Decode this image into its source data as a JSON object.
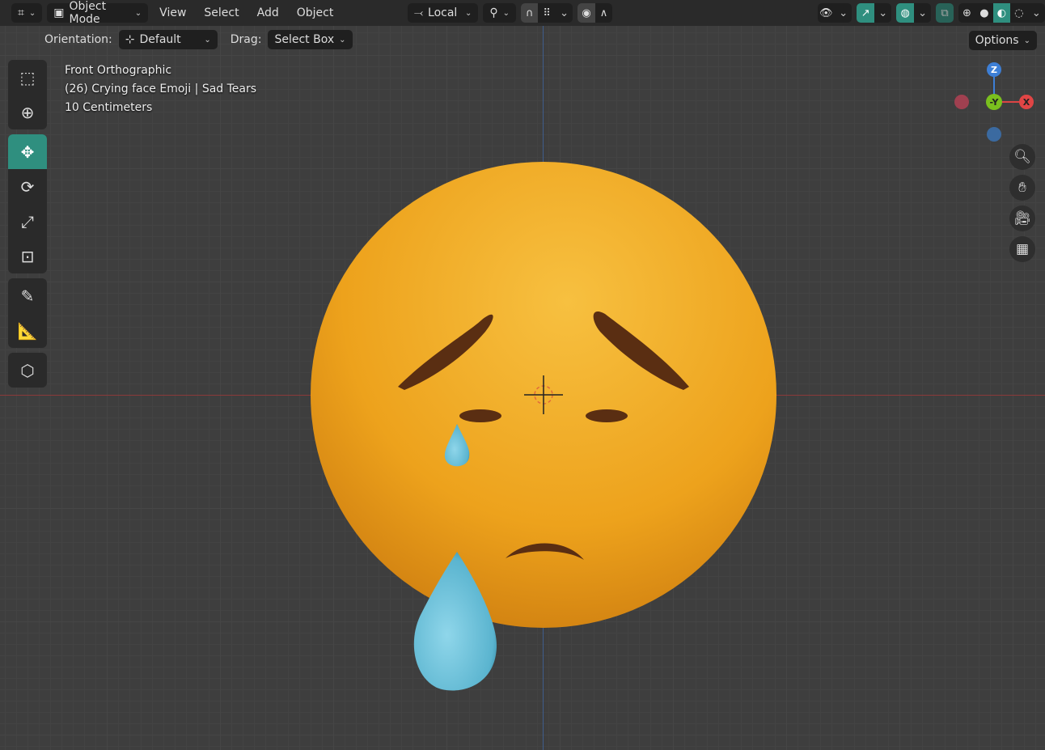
{
  "header": {
    "mode": "Object Mode",
    "menus": [
      "View",
      "Select",
      "Add",
      "Object"
    ],
    "transform_pivot": "Local"
  },
  "toolsettings": {
    "orientation_label": "Orientation:",
    "orientation_value": "Default",
    "drag_label": "Drag:",
    "drag_value": "Select Box",
    "options": "Options"
  },
  "overlay_info": {
    "view": "Front Orthographic",
    "object": "(26) Crying face Emoji | Sad Tears",
    "scale": "10 Centimeters"
  },
  "gizmo": {
    "z": "Z",
    "y": "-Y",
    "x": "X"
  },
  "colors": {
    "accent": "#2f8f7f",
    "face": "#f0a020",
    "tear": "#6fc3dc",
    "brow": "#5a2e12"
  }
}
